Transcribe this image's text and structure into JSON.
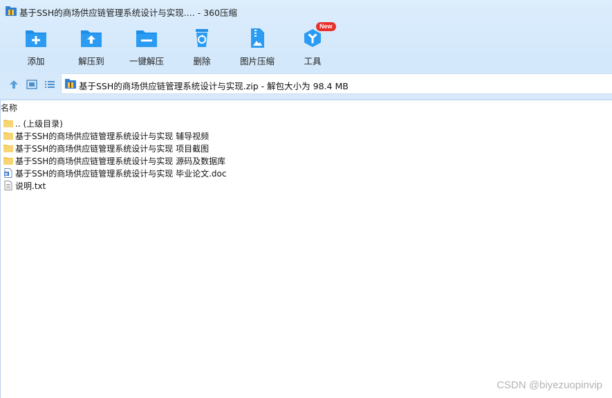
{
  "window": {
    "title": "基于SSH的商场供应链管理系统设计与实现.... - 360压缩"
  },
  "toolbar": {
    "items": [
      {
        "label": "添加",
        "icon": "add-folder-icon"
      },
      {
        "label": "解压到",
        "icon": "extract-to-icon"
      },
      {
        "label": "一键解压",
        "icon": "one-click-extract-icon"
      },
      {
        "label": "删除",
        "icon": "recycle-bin-icon"
      },
      {
        "label": "图片压缩",
        "icon": "image-compress-icon"
      },
      {
        "label": "工具",
        "icon": "tools-icon",
        "badge": "New"
      }
    ]
  },
  "nav": {
    "address": "基于SSH的商场供应链管理系统设计与实现.zip - 解包大小为 98.4 MB"
  },
  "list": {
    "column_name": "名称",
    "rows": [
      {
        "name": ".. (上级目录)",
        "type": "folder"
      },
      {
        "name": "基于SSH的商场供应链管理系统设计与实现 辅导视频",
        "type": "folder"
      },
      {
        "name": "基于SSH的商场供应链管理系统设计与实现 项目截图",
        "type": "folder"
      },
      {
        "name": "基于SSH的商场供应链管理系统设计与实现 源码及数据库",
        "type": "folder"
      },
      {
        "name": "基于SSH的商场供应链管理系统设计与实现 毕业论文.doc",
        "type": "doc"
      },
      {
        "name": "说明.txt",
        "type": "txt"
      }
    ]
  },
  "watermark": "CSDN @biyezuopinvip",
  "colors": {
    "accent": "#1e8fe8",
    "badge": "#e8302a",
    "folder": "#f7d575"
  }
}
